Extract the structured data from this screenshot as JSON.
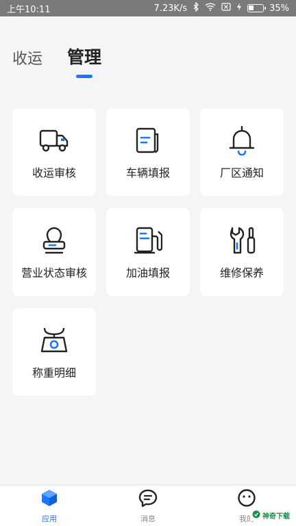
{
  "status_bar": {
    "time": "上午10:11",
    "net_speed": "7.23K/s",
    "battery": "35%"
  },
  "tabs": [
    {
      "label": "收运",
      "active": false
    },
    {
      "label": "管理",
      "active": true
    }
  ],
  "grid": [
    {
      "label": "收运审核",
      "icon": "truck-icon"
    },
    {
      "label": "车辆填报",
      "icon": "document-icon"
    },
    {
      "label": "厂区通知",
      "icon": "bell-icon"
    },
    {
      "label": "营业状态审核",
      "icon": "stamp-icon"
    },
    {
      "label": "加油填报",
      "icon": "fuel-pump-icon"
    },
    {
      "label": "维修保养",
      "icon": "wrench-screwdriver-icon"
    },
    {
      "label": "称重明细",
      "icon": "scale-icon"
    }
  ],
  "bottom_nav": [
    {
      "label": "应用",
      "icon": "cube-icon",
      "active": true
    },
    {
      "label": "消息",
      "icon": "chat-icon",
      "active": false
    },
    {
      "label": "我的",
      "icon": "face-icon",
      "active": false
    }
  ],
  "watermark": "神奇下载",
  "colors": {
    "accent": "#1677ff",
    "status_bar": "#7a7a7a",
    "background": "#f4f5f7"
  }
}
